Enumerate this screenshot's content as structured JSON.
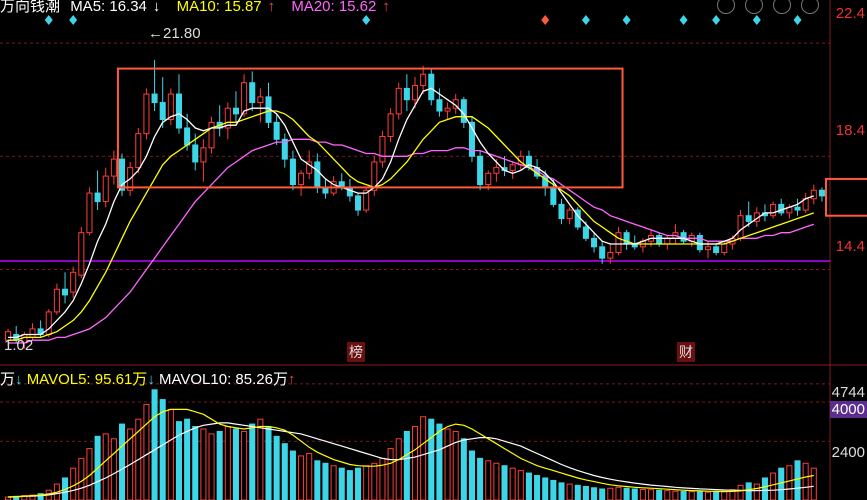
{
  "header": {
    "stock_name": "万向钱潮",
    "ma5_label": "MA5: 16.34",
    "ma5_arrow": "↓",
    "ma10_label": "MA10: 15.87",
    "ma10_arrow": "↑",
    "ma20_label": "MA20: 15.62",
    "ma20_arrow": "↑",
    "colors": {
      "ma5": "#ffffff",
      "ma10": "#ffff00",
      "ma20": "#ff66ff"
    }
  },
  "volume_header": {
    "prefix": "万",
    "prefix_arrow": "↓",
    "mavol5_label": "MAVOL5: 95.61万",
    "mavol5_arrow": "↓",
    "mavol10_label": "MAVOL10: 85.26万",
    "mavol10_arrow": "↑"
  },
  "annotations": {
    "high": "21.80",
    "low": "1.02",
    "marker_a": "榜",
    "marker_b": "财"
  },
  "chart_data": [
    {
      "type": "candlestick",
      "y_ticks": [
        "22.4",
        "18.4",
        "14.4"
      ],
      "ylim": [
        11.2,
        23.5
      ],
      "support_line": 14.7,
      "support_color": "#c000ff",
      "up_color": "#ff3b3b",
      "down_color": "#3dd6e8",
      "boxes": [
        {
          "from": 14,
          "to": 75,
          "y_low": 17.3,
          "y_high": 21.5
        },
        {
          "from": 101,
          "to": 116,
          "y_low": 16.3,
          "y_high": 17.6
        }
      ],
      "ohlc": [
        [
          11.9,
          12.3,
          11.7,
          12.2
        ],
        [
          12.1,
          12.4,
          11.8,
          11.9
        ],
        [
          11.8,
          12.2,
          11.6,
          12.1
        ],
        [
          12.0,
          12.5,
          11.9,
          12.3
        ],
        [
          12.3,
          12.6,
          12.0,
          12.1
        ],
        [
          12.1,
          13.0,
          12.0,
          12.9
        ],
        [
          12.9,
          13.9,
          12.8,
          13.7
        ],
        [
          13.7,
          14.3,
          13.2,
          13.5
        ],
        [
          13.6,
          14.5,
          13.4,
          14.3
        ],
        [
          14.2,
          15.9,
          14.1,
          15.7
        ],
        [
          15.7,
          17.3,
          15.6,
          17.1
        ],
        [
          17.1,
          17.9,
          16.5,
          16.8
        ],
        [
          16.8,
          18.0,
          16.6,
          17.7
        ],
        [
          17.7,
          18.6,
          17.4,
          18.3
        ],
        [
          18.3,
          18.5,
          17.0,
          17.2
        ],
        [
          17.2,
          18.2,
          17.0,
          18.0
        ],
        [
          18.0,
          19.4,
          17.8,
          19.2
        ],
        [
          19.2,
          20.8,
          19.0,
          20.6
        ],
        [
          20.6,
          21.8,
          20.0,
          20.3
        ],
        [
          20.3,
          21.2,
          19.4,
          19.7
        ],
        [
          19.7,
          20.8,
          19.5,
          20.6
        ],
        [
          20.6,
          21.3,
          19.2,
          19.4
        ],
        [
          19.4,
          19.9,
          18.6,
          18.8
        ],
        [
          18.8,
          19.2,
          17.9,
          18.2
        ],
        [
          18.2,
          19.0,
          17.5,
          18.7
        ],
        [
          18.7,
          19.8,
          18.5,
          19.6
        ],
        [
          19.6,
          20.2,
          19.1,
          19.4
        ],
        [
          19.4,
          20.3,
          19.0,
          20.1
        ],
        [
          20.1,
          20.7,
          19.6,
          19.9
        ],
        [
          19.9,
          21.3,
          19.8,
          21.0
        ],
        [
          21.0,
          21.4,
          20.0,
          20.3
        ],
        [
          20.3,
          20.8,
          19.6,
          20.5
        ],
        [
          20.5,
          21.0,
          19.4,
          19.6
        ],
        [
          19.6,
          19.9,
          18.8,
          19.0
        ],
        [
          19.0,
          19.2,
          18.0,
          18.3
        ],
        [
          18.3,
          18.6,
          17.2,
          17.4
        ],
        [
          17.4,
          17.9,
          17.0,
          17.8
        ],
        [
          17.8,
          18.6,
          17.6,
          18.2
        ],
        [
          18.2,
          18.5,
          17.1,
          17.3
        ],
        [
          17.3,
          17.6,
          16.9,
          17.1
        ],
        [
          17.1,
          17.7,
          17.0,
          17.5
        ],
        [
          17.5,
          17.8,
          17.2,
          17.3
        ],
        [
          17.3,
          17.6,
          16.8,
          17.0
        ],
        [
          17.0,
          17.1,
          16.3,
          16.5
        ],
        [
          16.5,
          17.3,
          16.4,
          17.2
        ],
        [
          17.2,
          18.4,
          17.0,
          18.2
        ],
        [
          18.2,
          19.3,
          18.0,
          19.1
        ],
        [
          19.1,
          20.1,
          18.9,
          19.9
        ],
        [
          19.9,
          21.0,
          19.7,
          20.8
        ],
        [
          20.8,
          21.3,
          20.0,
          20.4
        ],
        [
          20.4,
          21.2,
          20.1,
          20.9
        ],
        [
          20.9,
          21.6,
          20.6,
          21.3
        ],
        [
          21.3,
          21.5,
          20.2,
          20.4
        ],
        [
          20.4,
          20.8,
          19.8,
          20.0
        ],
        [
          20.0,
          20.3,
          19.7,
          20.1
        ],
        [
          20.1,
          20.6,
          19.9,
          20.4
        ],
        [
          20.4,
          20.5,
          19.4,
          19.6
        ],
        [
          19.6,
          19.8,
          18.2,
          18.4
        ],
        [
          18.4,
          18.6,
          17.2,
          17.4
        ],
        [
          17.4,
          17.9,
          17.2,
          17.8
        ],
        [
          17.8,
          18.3,
          17.5,
          18.0
        ],
        [
          18.0,
          18.4,
          17.7,
          17.9
        ],
        [
          17.9,
          18.2,
          17.6,
          18.1
        ],
        [
          18.1,
          18.6,
          17.9,
          18.4
        ],
        [
          18.4,
          18.6,
          17.9,
          18.0
        ],
        [
          18.0,
          18.3,
          17.6,
          17.7
        ],
        [
          17.7,
          17.9,
          17.0,
          17.3
        ],
        [
          17.3,
          17.6,
          16.6,
          16.7
        ],
        [
          16.7,
          16.9,
          16.0,
          16.2
        ],
        [
          16.2,
          16.6,
          16.0,
          16.5
        ],
        [
          16.5,
          16.6,
          15.8,
          15.9
        ],
        [
          15.9,
          16.1,
          15.4,
          15.5
        ],
        [
          15.5,
          15.7,
          15.0,
          15.2
        ],
        [
          15.2,
          15.4,
          14.6,
          14.8
        ],
        [
          14.8,
          15.3,
          14.6,
          15.0
        ],
        [
          15.0,
          15.9,
          14.9,
          15.7
        ],
        [
          15.7,
          15.8,
          15.1,
          15.3
        ],
        [
          15.3,
          15.6,
          15.1,
          15.2
        ],
        [
          15.2,
          15.5,
          15.0,
          15.4
        ],
        [
          15.4,
          15.8,
          15.2,
          15.6
        ],
        [
          15.6,
          15.7,
          15.2,
          15.3
        ],
        [
          15.3,
          15.6,
          15.1,
          15.5
        ],
        [
          15.5,
          16.0,
          15.3,
          15.7
        ],
        [
          15.7,
          15.8,
          15.3,
          15.4
        ],
        [
          15.4,
          15.7,
          15.2,
          15.6
        ],
        [
          15.6,
          15.7,
          15.0,
          15.1
        ],
        [
          15.1,
          15.4,
          14.8,
          15.2
        ],
        [
          15.2,
          15.3,
          14.9,
          15.0
        ],
        [
          15.0,
          15.4,
          14.9,
          15.3
        ],
        [
          15.3,
          15.6,
          15.1,
          15.5
        ],
        [
          15.5,
          16.5,
          15.4,
          16.3
        ],
        [
          16.3,
          16.8,
          15.9,
          16.1
        ],
        [
          16.1,
          16.6,
          15.9,
          16.4
        ],
        [
          16.4,
          16.7,
          16.1,
          16.3
        ],
        [
          16.3,
          16.8,
          16.2,
          16.7
        ],
        [
          16.7,
          16.9,
          16.3,
          16.4
        ],
        [
          16.4,
          16.7,
          16.2,
          16.6
        ],
        [
          16.6,
          16.9,
          16.3,
          16.5
        ],
        [
          16.5,
          17.1,
          16.4,
          16.9
        ],
        [
          16.9,
          17.4,
          16.7,
          17.2
        ],
        [
          17.2,
          17.3,
          16.8,
          17.0
        ]
      ],
      "ma5": [
        12.0,
        12.0,
        12.1,
        12.1,
        12.1,
        12.3,
        12.6,
        12.9,
        13.3,
        13.9,
        14.6,
        15.4,
        16.0,
        16.8,
        17.4,
        17.6,
        17.9,
        18.4,
        19.1,
        19.6,
        19.8,
        19.9,
        19.7,
        19.4,
        19.3,
        19.4,
        19.4,
        19.5,
        19.5,
        20.0,
        20.1,
        20.1,
        20.1,
        19.9,
        19.5,
        18.9,
        18.3,
        18.1,
        17.9,
        17.6,
        17.4,
        17.3,
        17.2,
        17.1,
        17.1,
        17.3,
        17.6,
        18.2,
        19.0,
        19.7,
        20.2,
        20.7,
        20.8,
        20.6,
        20.4,
        20.2,
        19.9,
        19.4,
        18.9,
        18.5,
        18.2,
        17.9,
        17.8,
        17.9,
        18.1,
        18.0,
        17.8,
        17.5,
        17.1,
        16.7,
        16.3,
        16.0,
        15.7,
        15.4,
        15.3,
        15.3,
        15.3,
        15.3,
        15.4,
        15.5,
        15.5,
        15.5,
        15.5,
        15.5,
        15.4,
        15.3,
        15.3,
        15.3,
        15.4,
        15.5,
        15.8,
        16.0,
        16.2,
        16.4,
        16.4,
        16.5,
        16.6,
        16.7,
        16.9,
        17.0
      ],
      "ma10": [
        11.9,
        11.9,
        12.0,
        12.0,
        12.0,
        12.1,
        12.2,
        12.4,
        12.6,
        12.9,
        13.3,
        13.8,
        14.3,
        14.9,
        15.5,
        16.1,
        16.6,
        17.1,
        17.6,
        18.1,
        18.4,
        18.6,
        18.8,
        19.0,
        19.2,
        19.4,
        19.5,
        19.6,
        19.6,
        19.7,
        19.8,
        19.9,
        20.0,
        20.0,
        19.9,
        19.7,
        19.4,
        19.1,
        18.9,
        18.6,
        18.3,
        18.0,
        17.7,
        17.5,
        17.4,
        17.3,
        17.4,
        17.6,
        17.9,
        18.2,
        18.6,
        19.0,
        19.3,
        19.6,
        19.7,
        19.8,
        19.8,
        19.8,
        19.6,
        19.4,
        19.1,
        18.8,
        18.5,
        18.2,
        18.0,
        17.8,
        17.6,
        17.4,
        17.2,
        17.0,
        16.7,
        16.4,
        16.1,
        15.9,
        15.7,
        15.5,
        15.4,
        15.3,
        15.3,
        15.3,
        15.3,
        15.3,
        15.3,
        15.3,
        15.3,
        15.3,
        15.3,
        15.3,
        15.3,
        15.4,
        15.5,
        15.6,
        15.7,
        15.8,
        15.9,
        16.0,
        16.1,
        16.2,
        16.3,
        16.4
      ],
      "ma20": [
        11.8,
        11.8,
        11.8,
        11.9,
        11.9,
        11.9,
        12.0,
        12.0,
        12.1,
        12.2,
        12.3,
        12.5,
        12.7,
        13.0,
        13.3,
        13.6,
        14.0,
        14.4,
        14.8,
        15.2,
        15.6,
        16.0,
        16.4,
        16.8,
        17.1,
        17.4,
        17.7,
        18.0,
        18.2,
        18.4,
        18.6,
        18.7,
        18.8,
        18.9,
        18.9,
        19.0,
        19.0,
        19.0,
        18.9,
        18.9,
        18.8,
        18.8,
        18.7,
        18.6,
        18.5,
        18.5,
        18.4,
        18.4,
        18.4,
        18.4,
        18.5,
        18.5,
        18.6,
        18.6,
        18.6,
        18.7,
        18.7,
        18.6,
        18.6,
        18.5,
        18.4,
        18.3,
        18.2,
        18.1,
        18.0,
        17.9,
        17.7,
        17.6,
        17.4,
        17.2,
        17.0,
        16.8,
        16.6,
        16.5,
        16.3,
        16.2,
        16.1,
        16.0,
        15.9,
        15.8,
        15.7,
        15.6,
        15.6,
        15.5,
        15.5,
        15.5,
        15.4,
        15.4,
        15.4,
        15.4,
        15.5,
        15.5,
        15.5,
        15.6,
        15.6,
        15.7,
        15.7,
        15.8,
        15.9,
        16.0
      ]
    },
    {
      "type": "bar",
      "y_ticks": [
        "4744",
        "4000",
        "2400"
      ],
      "ylim": [
        0,
        4900
      ],
      "volume": [
        120,
        150,
        180,
        200,
        260,
        400,
        650,
        900,
        1300,
        1700,
        2100,
        2600,
        2700,
        2500,
        3100,
        2900,
        3300,
        3900,
        4500,
        4100,
        3700,
        3200,
        3300,
        3000,
        2900,
        2700,
        2800,
        3000,
        2900,
        2800,
        3100,
        3300,
        3000,
        2600,
        2300,
        2000,
        1800,
        1900,
        1600,
        1500,
        1400,
        1300,
        1200,
        1300,
        1400,
        1500,
        1700,
        2100,
        2500,
        2800,
        3000,
        3400,
        3300,
        3100,
        2900,
        2800,
        2500,
        2000,
        1700,
        1600,
        1500,
        1400,
        1300,
        1200,
        1100,
        1000,
        900,
        800,
        700,
        650,
        600,
        550,
        500,
        450,
        480,
        520,
        480,
        450,
        430,
        420,
        400,
        380,
        360,
        350,
        340,
        330,
        320,
        340,
        360,
        420,
        600,
        700,
        650,
        900,
        1100,
        1300,
        1400,
        1600,
        1500,
        1300
      ],
      "mavol5": [
        130,
        140,
        160,
        180,
        200,
        250,
        320,
        430,
        580,
        760,
        1000,
        1300,
        1600,
        1900,
        2200,
        2500,
        2800,
        3100,
        3400,
        3600,
        3700,
        3700,
        3700,
        3600,
        3500,
        3300,
        3100,
        3000,
        2950,
        2900,
        2950,
        3000,
        3000,
        2950,
        2850,
        2650,
        2400,
        2150,
        1950,
        1800,
        1650,
        1550,
        1450,
        1400,
        1380,
        1380,
        1420,
        1500,
        1650,
        1850,
        2050,
        2300,
        2550,
        2800,
        3000,
        3100,
        3050,
        2900,
        2700,
        2500,
        2300,
        2100,
        1900,
        1700,
        1550,
        1400,
        1300,
        1200,
        1100,
        1000,
        900,
        820,
        750,
        680,
        620,
        580,
        550,
        520,
        500,
        480,
        460,
        440,
        420,
        400,
        385,
        370,
        360,
        350,
        345,
        350,
        370,
        420,
        470,
        540,
        620,
        700,
        780,
        860,
        940,
        1000
      ],
      "mavol10": [
        120,
        130,
        150,
        160,
        180,
        210,
        260,
        320,
        390,
        480,
        600,
        750,
        900,
        1080,
        1260,
        1450,
        1650,
        1850,
        2050,
        2250,
        2450,
        2650,
        2800,
        2950,
        3050,
        3100,
        3150,
        3150,
        3100,
        3050,
        3000,
        2950,
        2900,
        2850,
        2800,
        2750,
        2700,
        2600,
        2500,
        2400,
        2300,
        2200,
        2100,
        2000,
        1900,
        1800,
        1700,
        1650,
        1650,
        1700,
        1750,
        1850,
        1950,
        2050,
        2200,
        2350,
        2450,
        2500,
        2550,
        2550,
        2500,
        2400,
        2300,
        2200,
        2050,
        1900,
        1750,
        1600,
        1450,
        1320,
        1200,
        1100,
        1000,
        920,
        850,
        790,
        740,
        690,
        650,
        610,
        580,
        550,
        520,
        495,
        475,
        455,
        440,
        425,
        410,
        400,
        390,
        385,
        385,
        390,
        400,
        420,
        450,
        480,
        520,
        560
      ]
    }
  ]
}
